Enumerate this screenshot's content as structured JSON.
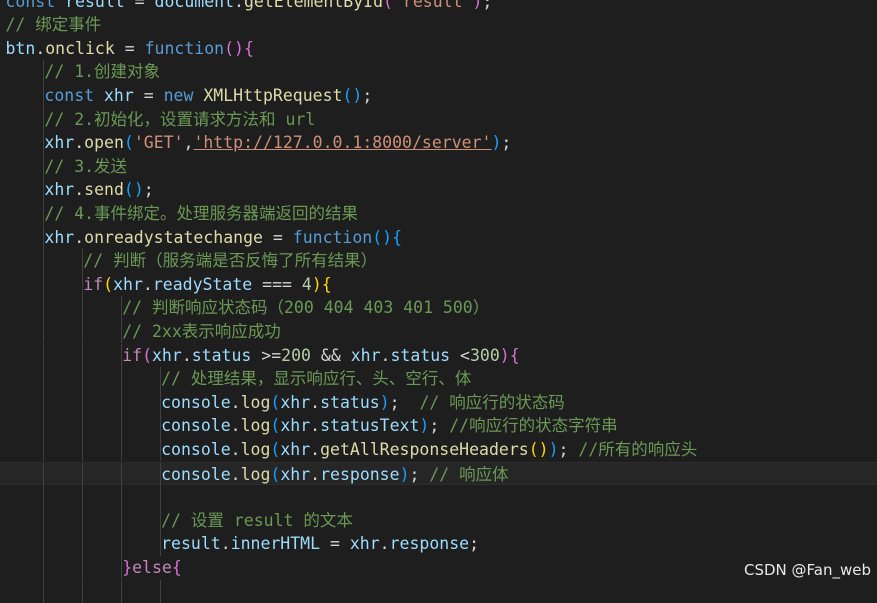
{
  "colors": {
    "background": "#1e1e1e",
    "plain": "#d4d4d4",
    "keyword": "#569cd6",
    "control": "#c586c0",
    "variable": "#9cdcfe",
    "function": "#dcdcaa",
    "string": "#ce9178",
    "number": "#b5cea8",
    "comment": "#6a9955",
    "bracket1": "#ffd700",
    "bracket2": "#da70d6",
    "bracket3": "#179fff"
  },
  "watermark": "CSDN @Fan_web",
  "code_lines": [
    {
      "indent": 1,
      "tokens": [
        [
          "const ",
          "keyword"
        ],
        [
          "result",
          "variable"
        ],
        [
          " = ",
          "plain"
        ],
        [
          "document",
          "variable"
        ],
        [
          ".",
          "plain"
        ],
        [
          "getElementById",
          "function"
        ],
        [
          "(",
          "bracket2"
        ],
        [
          "'result'",
          "string"
        ],
        [
          ")",
          "bracket2"
        ],
        [
          ";",
          "plain"
        ]
      ]
    },
    {
      "indent": 1,
      "tokens": [
        [
          "// 绑定事件",
          "comment"
        ]
      ]
    },
    {
      "indent": 1,
      "tokens": [
        [
          "btn",
          "variable"
        ],
        [
          ".",
          "plain"
        ],
        [
          "onclick",
          "function"
        ],
        [
          " = ",
          "plain"
        ],
        [
          "function",
          "keyword"
        ],
        [
          "()",
          "bracket2"
        ],
        [
          "{",
          "bracket2"
        ]
      ]
    },
    {
      "indent": 2,
      "tokens": [
        [
          "// 1.创建对象",
          "comment"
        ]
      ]
    },
    {
      "indent": 2,
      "tokens": [
        [
          "const ",
          "keyword"
        ],
        [
          "xhr",
          "variable"
        ],
        [
          " = ",
          "plain"
        ],
        [
          "new ",
          "keyword"
        ],
        [
          "XMLHttpRequest",
          "function"
        ],
        [
          "()",
          "bracket3"
        ],
        [
          ";",
          "plain"
        ]
      ]
    },
    {
      "indent": 2,
      "tokens": [
        [
          "// 2.初始化，设置请求方法和 url",
          "comment"
        ]
      ]
    },
    {
      "indent": 2,
      "tokens": [
        [
          "xhr",
          "variable"
        ],
        [
          ".",
          "plain"
        ],
        [
          "open",
          "function"
        ],
        [
          "(",
          "bracket3"
        ],
        [
          "'GET'",
          "string"
        ],
        [
          ",",
          "plain"
        ],
        [
          "'http://127.0.0.1:8000/server'",
          "string"
        ],
        [
          ")",
          "bracket3"
        ],
        [
          ";",
          "plain"
        ]
      ]
    },
    {
      "indent": 2,
      "tokens": [
        [
          "// 3.发送",
          "comment"
        ]
      ]
    },
    {
      "indent": 2,
      "tokens": [
        [
          "xhr",
          "variable"
        ],
        [
          ".",
          "plain"
        ],
        [
          "send",
          "function"
        ],
        [
          "()",
          "bracket3"
        ],
        [
          ";",
          "plain"
        ]
      ]
    },
    {
      "indent": 2,
      "tokens": [
        [
          "// 4.事件绑定。处理服务器端返回的结果",
          "comment"
        ]
      ]
    },
    {
      "indent": 2,
      "tokens": [
        [
          "xhr",
          "variable"
        ],
        [
          ".",
          "plain"
        ],
        [
          "onreadystatechange",
          "function"
        ],
        [
          " = ",
          "plain"
        ],
        [
          "function",
          "keyword"
        ],
        [
          "()",
          "bracket3"
        ],
        [
          "{",
          "bracket3"
        ]
      ]
    },
    {
      "indent": 3,
      "tokens": [
        [
          "// 判断（服务端是否反悔了所有结果）",
          "comment"
        ]
      ]
    },
    {
      "indent": 3,
      "tokens": [
        [
          "if",
          "control"
        ],
        [
          "(",
          "bracket1"
        ],
        [
          "xhr",
          "variable"
        ],
        [
          ".",
          "plain"
        ],
        [
          "readyState",
          "variable"
        ],
        [
          " === ",
          "plain"
        ],
        [
          "4",
          "number"
        ],
        [
          ")",
          "bracket1"
        ],
        [
          "{",
          "bracket1"
        ]
      ]
    },
    {
      "indent": 4,
      "tokens": [
        [
          "// 判断响应状态码（200 404 403 401 500）",
          "comment"
        ]
      ]
    },
    {
      "indent": 4,
      "tokens": [
        [
          "// 2xx表示响应成功",
          "comment"
        ]
      ]
    },
    {
      "indent": 4,
      "tokens": [
        [
          "if",
          "control"
        ],
        [
          "(",
          "bracket2"
        ],
        [
          "xhr",
          "variable"
        ],
        [
          ".",
          "plain"
        ],
        [
          "status",
          "variable"
        ],
        [
          " >=",
          "plain"
        ],
        [
          "200",
          "number"
        ],
        [
          " && ",
          "plain"
        ],
        [
          "xhr",
          "variable"
        ],
        [
          ".",
          "plain"
        ],
        [
          "status",
          "variable"
        ],
        [
          " <",
          "plain"
        ],
        [
          "300",
          "number"
        ],
        [
          ")",
          "bracket2"
        ],
        [
          "{",
          "bracket2"
        ]
      ]
    },
    {
      "indent": 5,
      "tokens": [
        [
          "// 处理结果，显示响应行、头、空行、体",
          "comment"
        ]
      ]
    },
    {
      "indent": 5,
      "tokens": [
        [
          "console",
          "variable"
        ],
        [
          ".",
          "plain"
        ],
        [
          "log",
          "function"
        ],
        [
          "(",
          "bracket3"
        ],
        [
          "xhr",
          "variable"
        ],
        [
          ".",
          "plain"
        ],
        [
          "status",
          "variable"
        ],
        [
          ")",
          "bracket3"
        ],
        [
          ";  ",
          "plain"
        ],
        [
          "// 响应行的状态码",
          "comment"
        ]
      ]
    },
    {
      "indent": 5,
      "tokens": [
        [
          "console",
          "variable"
        ],
        [
          ".",
          "plain"
        ],
        [
          "log",
          "function"
        ],
        [
          "(",
          "bracket3"
        ],
        [
          "xhr",
          "variable"
        ],
        [
          ".",
          "plain"
        ],
        [
          "statusText",
          "variable"
        ],
        [
          ")",
          "bracket3"
        ],
        [
          "; ",
          "plain"
        ],
        [
          "//响应行的状态字符串",
          "comment"
        ]
      ]
    },
    {
      "indent": 5,
      "tokens": [
        [
          "console",
          "variable"
        ],
        [
          ".",
          "plain"
        ],
        [
          "log",
          "function"
        ],
        [
          "(",
          "bracket3"
        ],
        [
          "xhr",
          "variable"
        ],
        [
          ".",
          "plain"
        ],
        [
          "getAllResponseHeaders",
          "function"
        ],
        [
          "()",
          "bracket1"
        ],
        [
          ")",
          "bracket3"
        ],
        [
          "; ",
          "plain"
        ],
        [
          "//所有的响应头",
          "comment"
        ]
      ]
    },
    {
      "indent": 5,
      "active": true,
      "tokens": [
        [
          "console",
          "variable"
        ],
        [
          ".",
          "plain"
        ],
        [
          "log",
          "function"
        ],
        [
          "(",
          "bracket3"
        ],
        [
          "xhr",
          "variable"
        ],
        [
          ".",
          "plain"
        ],
        [
          "response",
          "variable"
        ],
        [
          ")",
          "bracket3"
        ],
        [
          "; ",
          "plain"
        ],
        [
          "// 响应体",
          "comment"
        ]
      ]
    },
    {
      "indent": 5,
      "tokens": []
    },
    {
      "indent": 5,
      "tokens": [
        [
          "// 设置 result 的文本",
          "comment"
        ]
      ]
    },
    {
      "indent": 5,
      "tokens": [
        [
          "result",
          "variable"
        ],
        [
          ".",
          "plain"
        ],
        [
          "innerHTML",
          "variable"
        ],
        [
          " = ",
          "plain"
        ],
        [
          "xhr",
          "variable"
        ],
        [
          ".",
          "plain"
        ],
        [
          "response",
          "variable"
        ],
        [
          ";",
          "plain"
        ]
      ]
    },
    {
      "indent": 4,
      "tokens": [
        [
          "}",
          "bracket2"
        ],
        [
          "else",
          "control"
        ],
        [
          "{",
          "bracket2"
        ]
      ]
    },
    {
      "indent": 5,
      "tokens": []
    }
  ]
}
